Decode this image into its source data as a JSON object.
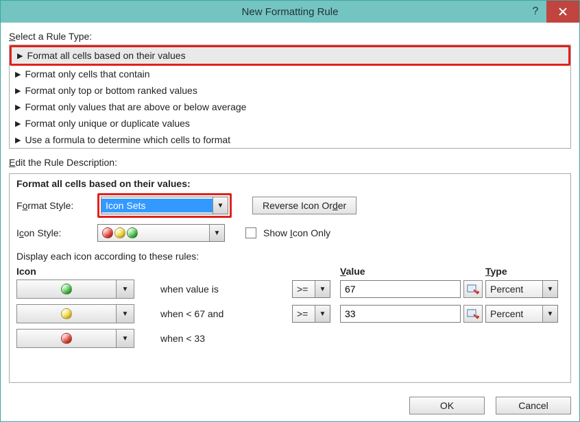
{
  "window": {
    "title": "New Formatting Rule",
    "help_tooltip": "?",
    "close_tooltip": "Close"
  },
  "labels": {
    "select_rule_type": "Select a Rule Type:",
    "edit_rule_description": "Edit the Rule Description:",
    "format_style": "Format Style:",
    "icon_style": "Icon Style:",
    "display_rules": "Display each icon according to these rules:",
    "reverse_icon_order": "Reverse Icon Order",
    "show_icon_only": "Show Icon Only"
  },
  "rule_types": [
    "Format all cells based on their values",
    "Format only cells that contain",
    "Format only top or bottom ranked values",
    "Format only values that are above or below average",
    "Format only unique or duplicate values",
    "Use a formula to determine which cells to format"
  ],
  "description": {
    "heading": "Format all cells based on their values:",
    "format_style_value": "Icon Sets",
    "icon_style_name": "3 Traffic Lights (Unrimmed)",
    "show_icon_only_checked": false
  },
  "columns": {
    "icon": "Icon",
    "value": "Value",
    "type": "Type"
  },
  "rules": [
    {
      "icon": "green",
      "when_text": "when value is",
      "op": ">=",
      "value": "67",
      "type": "Percent"
    },
    {
      "icon": "yellow",
      "when_text": "when < 67 and",
      "op": ">=",
      "value": "33",
      "type": "Percent"
    },
    {
      "icon": "red",
      "when_text": "when < 33",
      "op": "",
      "value": "",
      "type": ""
    }
  ],
  "buttons": {
    "ok": "OK",
    "cancel": "Cancel"
  }
}
